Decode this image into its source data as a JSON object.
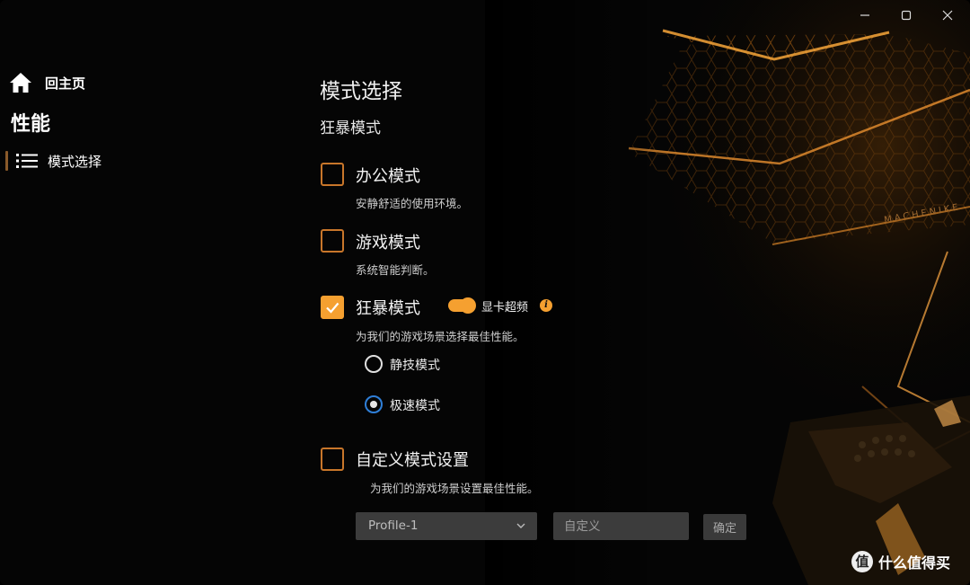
{
  "sidebar": {
    "home_label": "回主页",
    "section_title": "性能",
    "items": [
      {
        "label": "模式选择",
        "active": true
      }
    ]
  },
  "main": {
    "page_title": "模式选择",
    "current_mode": "狂暴模式",
    "modes": [
      {
        "label": "办公模式",
        "desc": "安静舒适的使用环境。",
        "checked": false
      },
      {
        "label": "游戏模式",
        "desc": "系统智能判断。",
        "checked": false
      },
      {
        "label": "狂暴模式",
        "desc": "为我们的游戏场景选择最佳性能。",
        "checked": true
      },
      {
        "label": "自定义模式设置",
        "desc": "为我们的游戏场景设置最佳性能。",
        "checked": false
      }
    ],
    "gpu_toggle": {
      "label": "显卡超频",
      "on": true
    },
    "sub_modes": [
      {
        "label": "静技模式",
        "selected": false
      },
      {
        "label": "极速模式",
        "selected": true
      }
    ],
    "profile_select": {
      "value": "Profile-1"
    },
    "custom_input": {
      "placeholder": "自定义"
    },
    "confirm_label": "确定"
  },
  "branding": {
    "art_text": "MACHENIKE"
  },
  "watermark": {
    "badge": "值",
    "text": "什么值得买"
  },
  "colors": {
    "accent": "#f5a030",
    "accent_border": "#c8762a",
    "radio_blue": "#2f7fd8"
  },
  "icons": [
    "minimize-icon",
    "maximize-icon",
    "close-icon",
    "home-icon",
    "list-icon",
    "checkmark-icon",
    "info-icon",
    "chevron-down-icon"
  ]
}
